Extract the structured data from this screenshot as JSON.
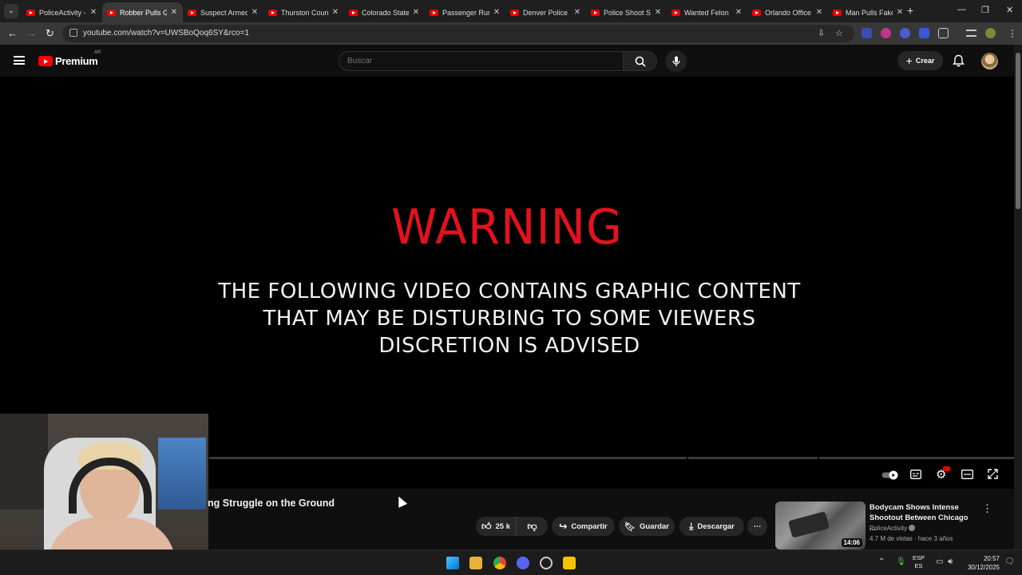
{
  "browser": {
    "tabs": [
      {
        "title": "PoliceActivity - ",
        "active": false
      },
      {
        "title": "Robber Pulls G",
        "active": true
      },
      {
        "title": "Suspect Armed",
        "active": false
      },
      {
        "title": "Thurston Coun",
        "active": false
      },
      {
        "title": "Colorado State",
        "active": false
      },
      {
        "title": "Passenger Run",
        "active": false
      },
      {
        "title": "Denver Police",
        "active": false
      },
      {
        "title": "Police Shoot S",
        "active": false
      },
      {
        "title": "Wanted Felon",
        "active": false
      },
      {
        "title": "Orlando Office",
        "active": false
      },
      {
        "title": "Man Pulls Fake",
        "active": false
      }
    ],
    "tab_close_glyph": "✕",
    "new_tab_glyph": "+",
    "url": "youtube.com/watch?v=UWSBoQoq6SY&rco=1"
  },
  "youtube": {
    "logo_text": "Premium",
    "country_code": "AR",
    "search_placeholder": "Buscar",
    "create_label": "Crear",
    "create_glyph": "+"
  },
  "video": {
    "warning_title": "WARNING",
    "warning_lines": [
      "THE FOLLOWING VIDEO CONTAINS GRAPHIC CONTENT",
      "THAT MAY BE DISTURBING TO SOME VIEWERS",
      "DISCRETION IS ADVISED"
    ],
    "title_visible": "ng Struggle on the Ground",
    "likes": "25 k",
    "share_label": "Compartir",
    "save_label": "Guardar",
    "download_label": "Descargar"
  },
  "recommendation": {
    "title": "Bodycam Shows Intense Shootout Between Chicago ...",
    "channel": "PoliceActivity",
    "meta": "4.7 M de vistas · hace 3 años",
    "duration": "14:06"
  },
  "taskbar": {
    "lang_top": "ESP",
    "lang_bottom": "ES",
    "time": "20:57",
    "date": "30/12/2025"
  },
  "colors": {
    "warning_red": "#e4121d",
    "youtube_red": "#ff0000",
    "background": "#0f0f0f"
  }
}
